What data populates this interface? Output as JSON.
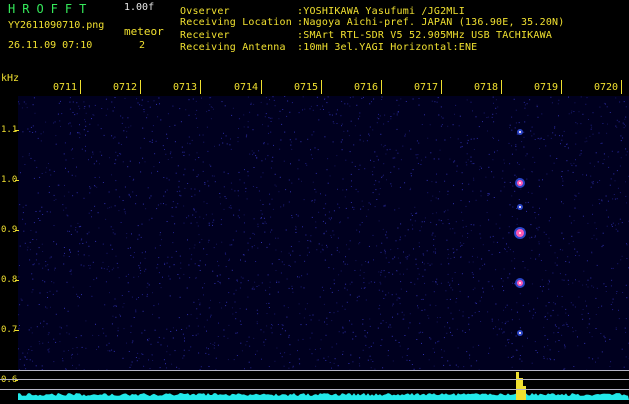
{
  "app": {
    "title": "HROFFT",
    "version": "1.00f"
  },
  "file": {
    "name": "YY2611090710.png",
    "datetime": "26.11.09 07:10"
  },
  "meteor": {
    "label": "meteor",
    "count": "2"
  },
  "info": [
    {
      "key": "Ovserver",
      "value": ":YOSHIKAWA Yasufumi /JG2MLI"
    },
    {
      "key": "Receiving Location",
      "value": ":Nagoya Aichi-pref. JAPAN (136.90E, 35.20N)"
    },
    {
      "key": "Receiver",
      "value": ":SMArt RTL-SDR V5 52.905MHz USB TACHIKAWA"
    },
    {
      "key": "Receiving Antenna",
      "value": ":10mH 3el.YAGI Horizontal:ENE"
    }
  ],
  "y_unit": "kHz",
  "time_ticks": [
    "0711",
    "0712",
    "0713",
    "0714",
    "0715",
    "0716",
    "0717",
    "0718",
    "0719",
    "0720"
  ],
  "freq_ticks": [
    "1.1",
    "1.0",
    "0.9",
    "0.8",
    "0.7",
    "0.6"
  ],
  "colors": {
    "label": "#f0e030",
    "title": "#35e85a",
    "background": "#00001f",
    "spectrum": "#22e8e8",
    "meteor_peak": "#f0e030"
  }
}
